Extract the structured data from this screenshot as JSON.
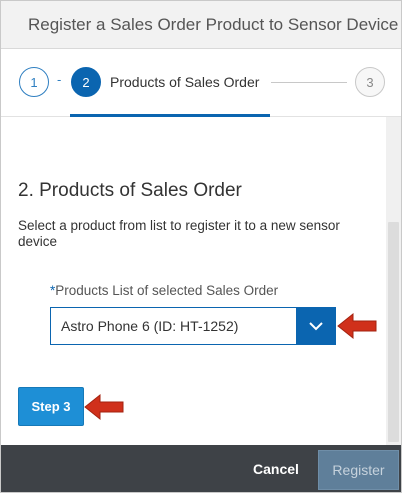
{
  "dialog": {
    "title": "Register a Sales Order Product to Sensor Device"
  },
  "wizard": {
    "steps": [
      {
        "number": "1",
        "state": "completed"
      },
      {
        "number": "2",
        "label": "Products of Sales Order",
        "state": "active"
      },
      {
        "number": "3",
        "state": "pending"
      }
    ],
    "separator": "-"
  },
  "content": {
    "section_title": "2. Products of Sales Order",
    "description": "Select a product from list to register it to a new sensor device",
    "field": {
      "required_marker": "*",
      "label": "Products List of selected Sales Order",
      "value": "Astro Phone 6 (ID: HT-1252)",
      "dropdown_icon": "chevron-down-icon"
    },
    "next_step_button": "Step 3"
  },
  "footer": {
    "cancel_label": "Cancel",
    "register_label": "Register"
  },
  "colors": {
    "accent": "#0b65b0",
    "step_button": "#1e8fd6",
    "footer_bg": "#3e4247",
    "annotation_arrow": "#d0301b"
  }
}
